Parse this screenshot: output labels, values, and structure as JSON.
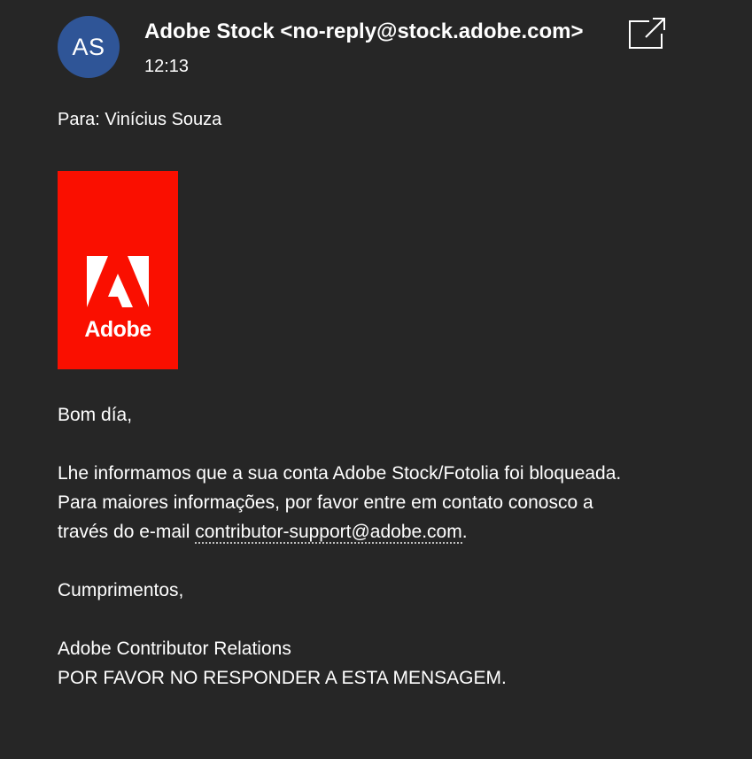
{
  "header": {
    "avatar_initials": "AS",
    "avatar_color": "#2f5597",
    "sender": "Adobe Stock <no-reply@stock.adobe.com>",
    "time": "12:13",
    "popout_icon": "open-in-new-window-icon"
  },
  "recipient": {
    "line": "Para: Vinícius Souza"
  },
  "logo": {
    "text": "Adobe",
    "color": "#fa0f00"
  },
  "message": {
    "greeting": "Bom día,",
    "para1_line1": "Lhe informamos que a sua conta Adobe Stock/Fotolia foi bloqueada.",
    "para1_line2": "Para maiores informações, por favor entre em contato conosco a",
    "para1_line3_prefix": "través do e-mail ",
    "email_link": "contributor-support@adobe.com",
    "para1_line3_suffix": ".",
    "closing": "Cumprimentos,",
    "signature": "Adobe Contributor Relations",
    "warning": "POR FAVOR NO RESPONDER A ESTA MENSAGEM."
  }
}
